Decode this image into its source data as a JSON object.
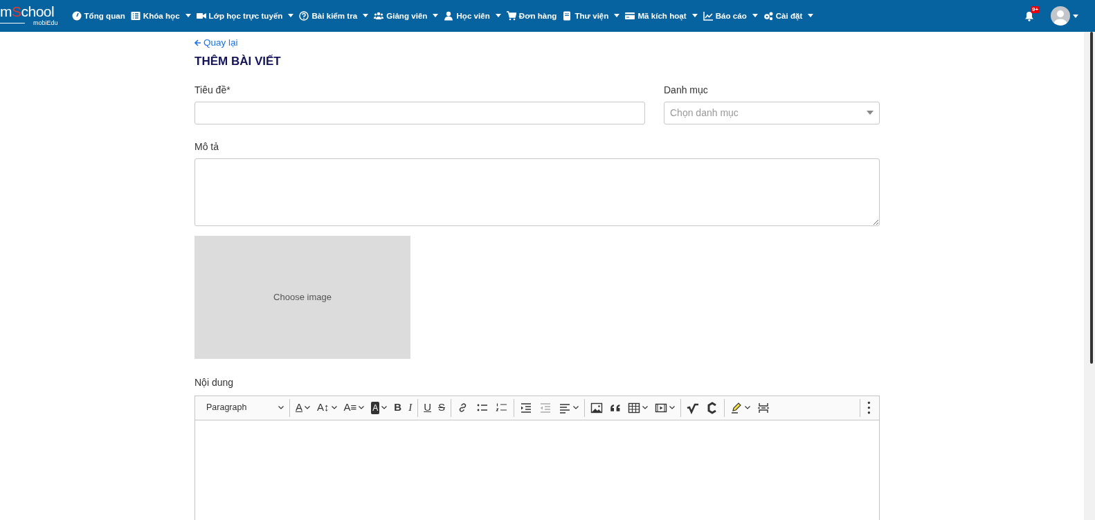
{
  "navbar": {
    "logo": {
      "brand": "mSchool",
      "sub": "mobiEdu"
    },
    "items": [
      {
        "label": "Tổng quan",
        "dropdown": false
      },
      {
        "label": "Khóa học",
        "dropdown": true
      },
      {
        "label": "Lớp học trực tuyến",
        "dropdown": true
      },
      {
        "label": "Bài kiểm tra",
        "dropdown": true
      },
      {
        "label": "Giảng viên",
        "dropdown": true
      },
      {
        "label": "Học viên",
        "dropdown": true
      },
      {
        "label": "Đơn hàng",
        "dropdown": false
      },
      {
        "label": "Thư viện",
        "dropdown": true
      },
      {
        "label": "Mã kích hoạt",
        "dropdown": true
      },
      {
        "label": "Báo cáo",
        "dropdown": true
      },
      {
        "label": "Cài đặt",
        "dropdown": true
      }
    ],
    "notifications": {
      "badge": "9+"
    }
  },
  "back_link": "Quay lại",
  "page_title": "THÊM BÀI VIẾT",
  "form": {
    "title_label": "Tiêu đề*",
    "category_label": "Danh mục",
    "category_placeholder": "Chọn danh mục",
    "description_label": "Mô tả",
    "image_button": "Choose image",
    "content_label": "Nội dung"
  },
  "editor": {
    "toolbar_groups": [
      [
        {
          "kind": "dropdown",
          "label": "Paragraph",
          "caret": true,
          "disabled": false
        }
      ],
      [
        {
          "kind": "glyph",
          "glyph": "A",
          "caret": true,
          "disabled": false
        },
        {
          "kind": "glyph",
          "glyph": "A↕",
          "caret": true,
          "disabled": false
        },
        {
          "kind": "glyph",
          "glyph": "A≡",
          "caret": true,
          "disabled": false
        },
        {
          "kind": "glyph",
          "glyph": "A",
          "caret": true,
          "disabled": false
        },
        {
          "kind": "glyph",
          "glyph": "B",
          "caret": false,
          "disabled": false
        },
        {
          "kind": "glyph",
          "glyph": "I",
          "caret": false,
          "disabled": false
        }
      ],
      [
        {
          "kind": "glyph",
          "glyph": "U",
          "caret": false,
          "disabled": false
        },
        {
          "kind": "glyph",
          "glyph": "S",
          "caret": false,
          "disabled": false
        }
      ],
      [
        {
          "kind": "icon",
          "caret": false,
          "disabled": false
        },
        {
          "kind": "icon",
          "caret": false,
          "disabled": false
        },
        {
          "kind": "icon",
          "caret": false,
          "disabled": false
        }
      ],
      [
        {
          "kind": "icon",
          "caret": false,
          "disabled": false
        },
        {
          "kind": "icon",
          "caret": false,
          "disabled": true
        },
        {
          "kind": "icon",
          "caret": true,
          "disabled": false
        }
      ],
      [
        {
          "kind": "icon",
          "caret": false,
          "disabled": false
        },
        {
          "kind": "icon",
          "caret": false,
          "disabled": false
        },
        {
          "kind": "icon",
          "caret": true,
          "disabled": false
        },
        {
          "kind": "icon",
          "caret": true,
          "disabled": false
        }
      ],
      [
        {
          "kind": "icon",
          "caret": false,
          "disabled": false
        },
        {
          "kind": "icon",
          "caret": false,
          "disabled": false
        }
      ],
      [
        {
          "kind": "icon",
          "caret": true,
          "disabled": false
        },
        {
          "kind": "icon",
          "caret": false,
          "disabled": false
        }
      ],
      [
        {
          "kind": "icon",
          "caret": false,
          "disabled": false
        }
      ]
    ]
  }
}
